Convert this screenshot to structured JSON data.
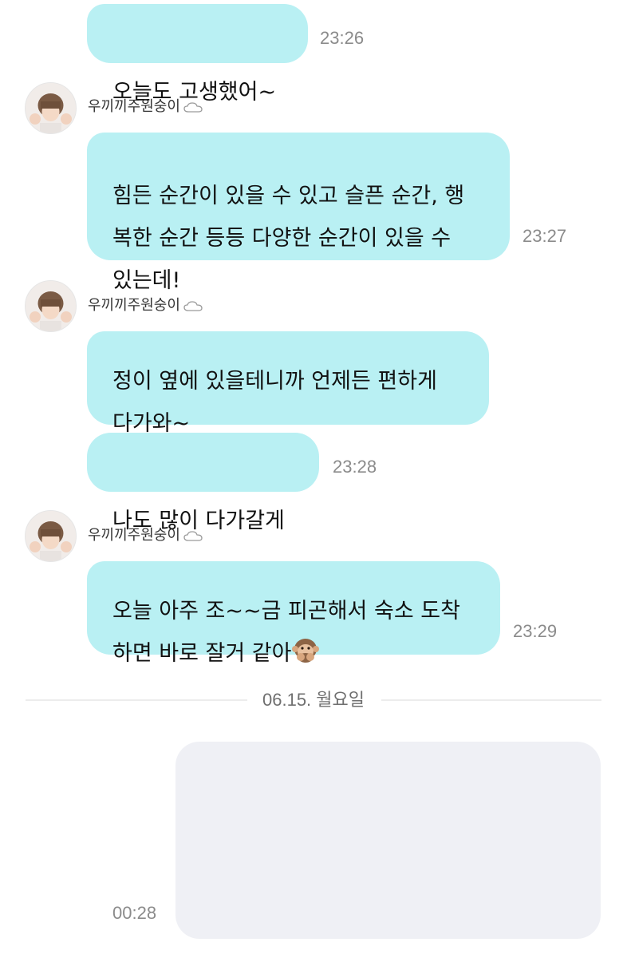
{
  "sender_name": "우끼끼주원숭이",
  "messages": [
    {
      "text": "오늘도 고생했어~",
      "time": "23:26"
    },
    {
      "text": "힘든 순간이 있을 수 있고 슬픈 순간, 행\n복한 순간 등등 다양한 순간이 있을 수\n있는데!",
      "time": "23:27"
    },
    {
      "text": "정이 옆에 있을테니까 언제든 편하게\n다가와~"
    },
    {
      "text": "나도 많이 다가갈게",
      "time": "23:28"
    },
    {
      "text": "오늘 아주 조~~금 피곤해서 숙소 도착\n하면 바로 잘거 같아",
      "emoji": "speak-no-evil-monkey-icon",
      "time": "23:29"
    }
  ],
  "date_divider": "06.15. 월요일",
  "outgoing": {
    "type": "image",
    "time": "00:28"
  },
  "colors": {
    "incoming_bubble": "#b9f0f3",
    "outgoing_image_bg": "#eff0f5",
    "timestamp": "#8b8b8b"
  }
}
